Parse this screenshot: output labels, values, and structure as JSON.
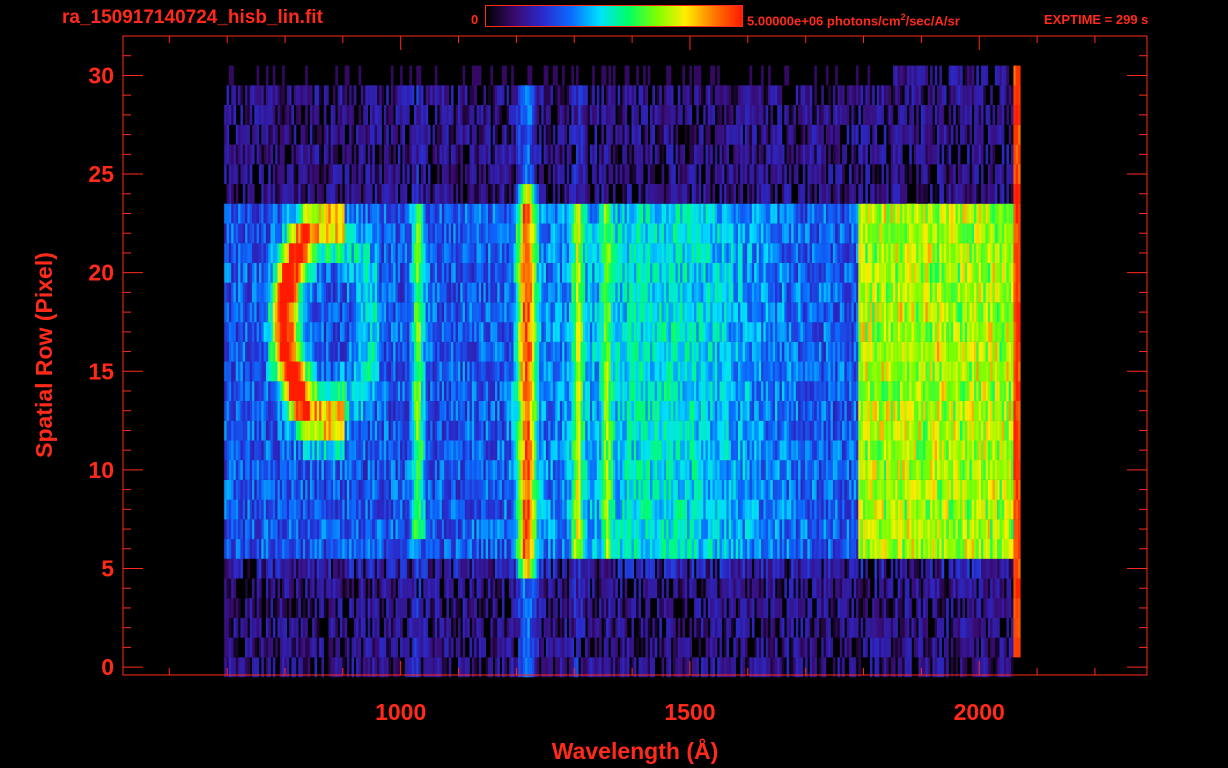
{
  "header": {
    "file_title": "ra_150917140724_hisb_lin.fit",
    "colorbar_min_label": "0",
    "colorbar_max_value": "5.00000e+06 photons/cm",
    "colorbar_max_exp": "2",
    "colorbar_max_suffix": "/sec/A/sr",
    "exptime_label": "EXPTIME = 299 s"
  },
  "colors": {
    "axis": "#ff2a1a",
    "background": "#000000",
    "colormap": [
      "#000000",
      "#3a0a6e",
      "#2a2acc",
      "#0a6cff",
      "#00e0ff",
      "#00ff66",
      "#7cff00",
      "#ffee00",
      "#ff7a00",
      "#ff1a00"
    ]
  },
  "chart_data": {
    "type": "heatmap",
    "title": "ra_150917140724_hisb_lin.fit",
    "xlabel": "Wavelength (Å)",
    "ylabel": "Spatial Row (Pixel)",
    "xlim": [
      520,
      2290
    ],
    "ylim": [
      -0.4,
      32
    ],
    "x_ticks": [
      1000,
      1500,
      2000
    ],
    "y_ticks": [
      0,
      5,
      10,
      15,
      20,
      25,
      30
    ],
    "x_minor_step": 100,
    "y_minor_step": 1,
    "colorbar": {
      "min": 0,
      "max": 5000000,
      "units": "photons/cm^2/sec/A/sr"
    },
    "exptime_s": 299,
    "data_extent": {
      "x": [
        695,
        2070
      ],
      "rows": [
        0,
        30
      ]
    },
    "spatial_band_rows": [
      6,
      23
    ],
    "features": [
      {
        "desc": "arc bright ring",
        "x_center": 870,
        "row_center": 17.5,
        "intensity": 0.75
      },
      {
        "desc": "line",
        "x": 1028,
        "rows": [
          7,
          23
        ],
        "intensity": 0.45
      },
      {
        "desc": "Lyman-alpha line",
        "x": 1216,
        "rows": [
          5,
          24
        ],
        "intensity": 0.85
      },
      {
        "desc": "line",
        "x": 1304,
        "rows": [
          6,
          23
        ],
        "intensity": 0.45
      },
      {
        "desc": "continuum region",
        "x": [
          1800,
          2060
        ],
        "rows": [
          6,
          23
        ],
        "intensity": 0.55
      },
      {
        "desc": "edge line",
        "x": 2066,
        "rows": [
          1,
          30
        ],
        "intensity": 0.95
      }
    ]
  }
}
